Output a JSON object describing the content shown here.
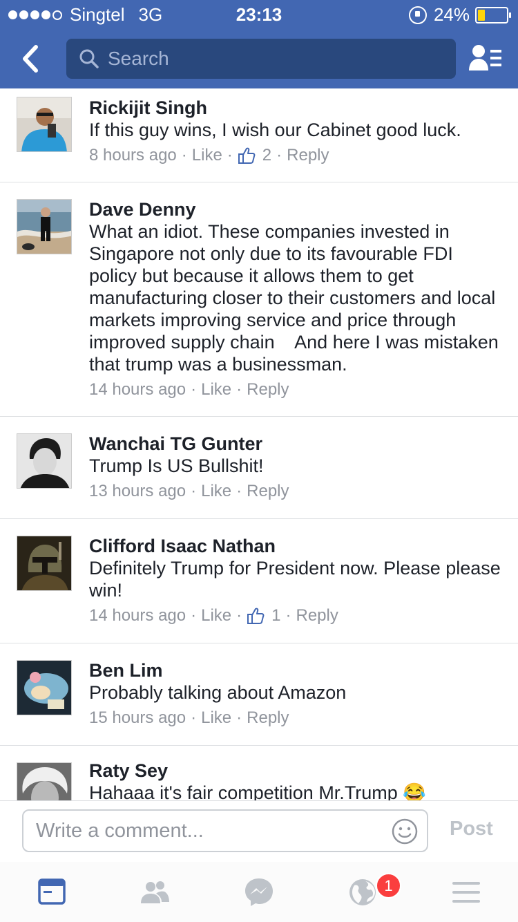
{
  "status_bar": {
    "carrier": "Singtel",
    "network": "3G",
    "time": "23:13",
    "battery_percent": "24%",
    "battery_level": 0.24,
    "signal_bars": 4,
    "signal_total": 5
  },
  "nav": {
    "search_placeholder": "Search",
    "back_icon": "chevron-left-icon",
    "friends_icon": "friend-list-icon"
  },
  "comments": [
    {
      "name": "Rickijit Singh",
      "text": "If this guy wins, I wish our Cabinet good luck.",
      "time": "8 hours ago",
      "like_label": "Like",
      "reaction_count": "2",
      "reply_label": "Reply"
    },
    {
      "name": "Dave Denny",
      "text": "What an idiot. These companies invested in Singapore not only due to its favourable FDI policy but because it allows them to get manufacturing closer to their customers and local markets improving service and price through improved supply chain    And here I was mistaken that trump was a businessman.",
      "time": "14 hours ago",
      "like_label": "Like",
      "reply_label": "Reply"
    },
    {
      "name": "Wanchai TG Gunter",
      "text": "Trump Is US Bullshit!",
      "time": "13 hours ago",
      "like_label": "Like",
      "reply_label": "Reply"
    },
    {
      "name": "Clifford Isaac Nathan",
      "text": "Definitely Trump for President now. Please please win!",
      "time": "14 hours ago",
      "like_label": "Like",
      "reaction_count": "1",
      "reply_label": "Reply"
    },
    {
      "name": "Ben Lim",
      "text": "Probably talking about Amazon",
      "time": "15 hours ago",
      "like_label": "Like",
      "reply_label": "Reply"
    },
    {
      "name": "Raty Sey",
      "text": "Hahaaa it's fair competition Mr.Trump 😂"
    }
  ],
  "composer": {
    "placeholder": "Write a comment...",
    "post_label": "Post"
  },
  "tabbar": {
    "notifications_badge": "1",
    "tabs": [
      "news-feed-icon",
      "friends-icon",
      "messenger-icon",
      "notifications-globe-icon",
      "menu-icon"
    ]
  },
  "colors": {
    "brand": "#4267b2",
    "search_bg": "#29487d",
    "active_tab": "#4267b2",
    "badge": "#fa3e3e",
    "meta_text": "#90949c"
  }
}
